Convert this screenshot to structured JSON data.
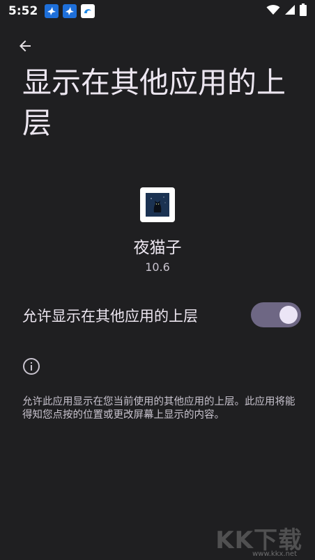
{
  "status_bar": {
    "time": "5:52",
    "notification_icons": [
      "bird-icon",
      "bird-icon",
      "wave-icon"
    ],
    "system_icons": [
      "wifi-icon",
      "signal-icon",
      "battery-icon"
    ]
  },
  "header": {
    "back_icon": "arrow-left-icon",
    "title": "显示在其他应用的上层"
  },
  "app": {
    "name": "夜猫子",
    "version": "10.6"
  },
  "permission": {
    "label": "允许显示在其他应用的上层",
    "enabled": true
  },
  "info": {
    "icon": "info-icon",
    "description": "允许此应用显示在您当前使用的其他应用的上层。此应用将能得知您点按的位置或更改屏幕上显示的内容。"
  },
  "watermark": {
    "text": "KK下载",
    "url": "www.kkx.net"
  },
  "colors": {
    "background": "#1f1f21",
    "switch_track": "#6e6784",
    "switch_thumb": "#ebe5f6",
    "notif_icon_bg": "#1e6fd9"
  }
}
